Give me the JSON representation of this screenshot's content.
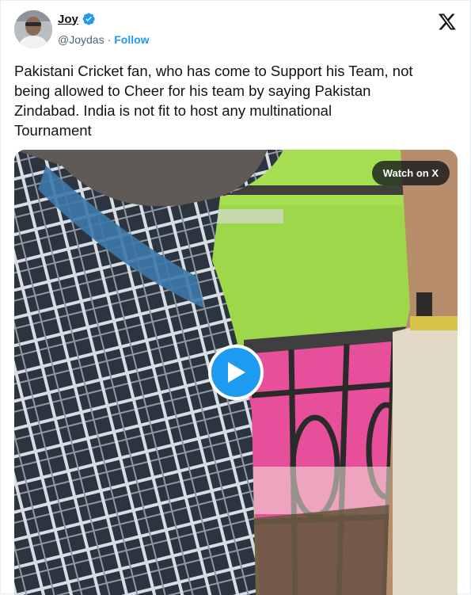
{
  "author": {
    "name": "Joy",
    "handle": "@Joydas",
    "separator": "·",
    "follow_label": "Follow",
    "verified": true
  },
  "tweet": {
    "text": "Pakistani Cricket fan, who has come to Support his Team, not\nbeing allowed to Cheer for his team by saying Pakistan\nZindabad. India is not fit to host any multinational\nTournament"
  },
  "media": {
    "watch_label": "Watch on X"
  },
  "icons": {
    "close": "x-logo-icon",
    "verified": "verified-badge-icon",
    "play": "play-icon"
  },
  "colors": {
    "accent": "#1d9bf0",
    "text": "#0f1419",
    "secondary": "#536471"
  }
}
